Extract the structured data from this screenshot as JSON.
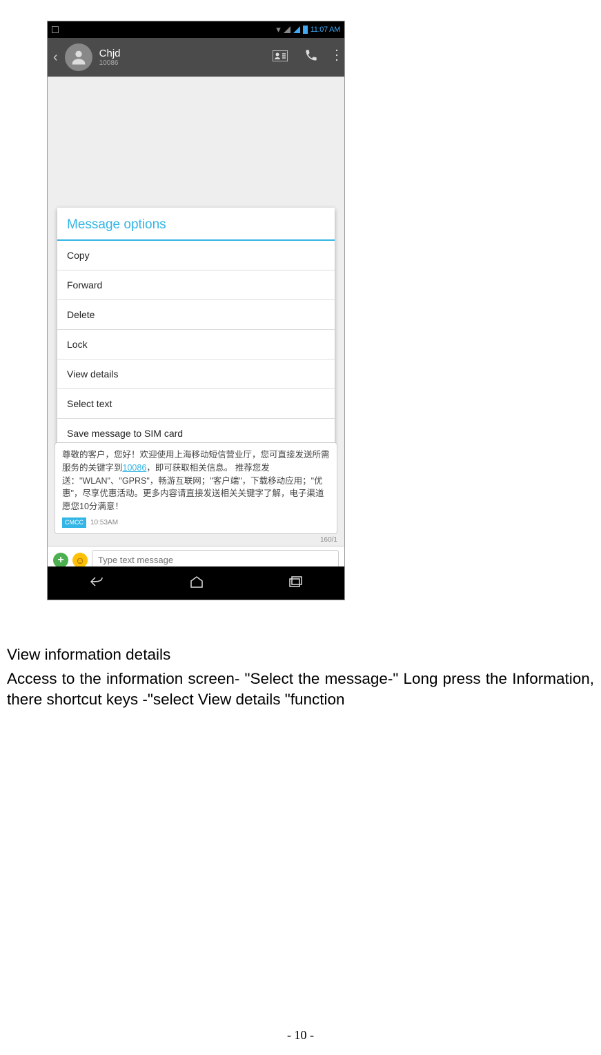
{
  "status_bar": {
    "time": "11:07 AM"
  },
  "header": {
    "contact_name": "Chjd",
    "contact_sub": "10086"
  },
  "dialog": {
    "title": "Message options",
    "items": [
      "Copy",
      "Forward",
      "Delete",
      "Lock",
      "View details",
      "Select text",
      "Save message to SIM card"
    ]
  },
  "bubble": {
    "text_pre": "尊敬的客户，您好！欢迎使用上海移动短信营业厅，您可直接发送所需服务的关键字到",
    "link": "10086",
    "text_post": "，即可获取相关信息。 推荐您发送：\"WLAN\"、\"GPRS\"，畅游互联网；\"客户端\"，下载移动应用；\"优惠\"，尽享优惠活动。更多内容请直接发送相关关键字了解，电子渠道愿您10分满意！",
    "tag": "CMCC",
    "time": "10:53AM"
  },
  "counter": "160/1",
  "input": {
    "placeholder": "Type text message"
  },
  "doc": {
    "heading": "View information details",
    "body": "Access to the information screen- \"Select the message-\" Long press the Information, there shortcut keys -\"select View details \"function"
  },
  "page_number": "- 10 -"
}
